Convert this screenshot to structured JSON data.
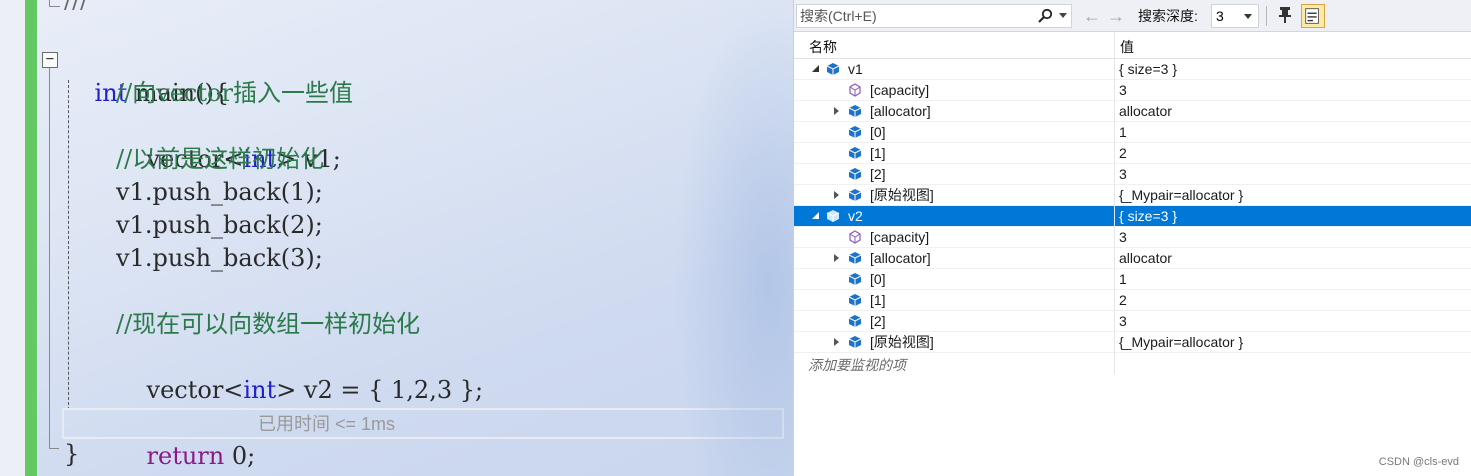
{
  "editor": {
    "top_fragment": "///",
    "lines": [
      {
        "kind": "signature",
        "kw": "int",
        "rest": " main(){"
      },
      {
        "kind": "comment",
        "text": "//向vector插入一些值"
      },
      {
        "kind": "decl",
        "pre": "vector<",
        "kw": "int",
        "post": "> v1;"
      },
      {
        "kind": "comment",
        "text": "//以前是这样初始化"
      },
      {
        "kind": "plain",
        "text": "v1.push_back(1);"
      },
      {
        "kind": "plain",
        "text": "v1.push_back(2);"
      },
      {
        "kind": "plain",
        "text": "v1.push_back(3);"
      },
      {
        "kind": "comment",
        "text": "//现在可以向数组一样初始化"
      },
      {
        "kind": "decl",
        "pre": "vector<",
        "kw": "int",
        "post": "> v2 = { 1,2,3 };"
      },
      {
        "kind": "return",
        "kw": "return",
        "rest": " 0;"
      },
      {
        "kind": "brace",
        "text": "}"
      }
    ],
    "perf_tip": "已用时间 <= 1ms",
    "outline_symbol": "−"
  },
  "watch": {
    "search_placeholder": "搜索(Ctrl+E)",
    "depth_label": "搜索深度:",
    "depth_value": "3",
    "col_name": "名称",
    "col_value": "值",
    "rows": [
      {
        "name": "v1",
        "value": "{ size=3 }",
        "level": 0,
        "expander": "open",
        "icon": "object",
        "selected": false
      },
      {
        "name": "[capacity]",
        "value": "3",
        "level": 1,
        "expander": "none",
        "icon": "field",
        "selected": false
      },
      {
        "name": "[allocator]",
        "value": "allocator",
        "level": 1,
        "expander": "closed",
        "icon": "object",
        "selected": false
      },
      {
        "name": "[0]",
        "value": "1",
        "level": 1,
        "expander": "none",
        "icon": "object",
        "selected": false
      },
      {
        "name": "[1]",
        "value": "2",
        "level": 1,
        "expander": "none",
        "icon": "object",
        "selected": false
      },
      {
        "name": "[2]",
        "value": "3",
        "level": 1,
        "expander": "none",
        "icon": "object",
        "selected": false
      },
      {
        "name": "[原始视图]",
        "value": "{_Mypair=allocator }",
        "level": 1,
        "expander": "closed",
        "icon": "object",
        "selected": false
      },
      {
        "name": "v2",
        "value": "{ size=3 }",
        "level": 0,
        "expander": "open",
        "icon": "object",
        "selected": true
      },
      {
        "name": "[capacity]",
        "value": "3",
        "level": 1,
        "expander": "none",
        "icon": "field",
        "selected": false
      },
      {
        "name": "[allocator]",
        "value": "allocator",
        "level": 1,
        "expander": "closed",
        "icon": "object",
        "selected": false
      },
      {
        "name": "[0]",
        "value": "1",
        "level": 1,
        "expander": "none",
        "icon": "object",
        "selected": false
      },
      {
        "name": "[1]",
        "value": "2",
        "level": 1,
        "expander": "none",
        "icon": "object",
        "selected": false
      },
      {
        "name": "[2]",
        "value": "3",
        "level": 1,
        "expander": "none",
        "icon": "object",
        "selected": false
      },
      {
        "name": "[原始视图]",
        "value": "{_Mypair=allocator }",
        "level": 1,
        "expander": "closed",
        "icon": "object",
        "selected": false
      }
    ],
    "add_item": "添加要监视的项"
  },
  "watermark": "CSDN @cls-evd",
  "colors": {
    "keyword": "#2020d0",
    "comment": "#2a7a4a",
    "selection": "#0078d7",
    "change_bar": "#64c864"
  }
}
